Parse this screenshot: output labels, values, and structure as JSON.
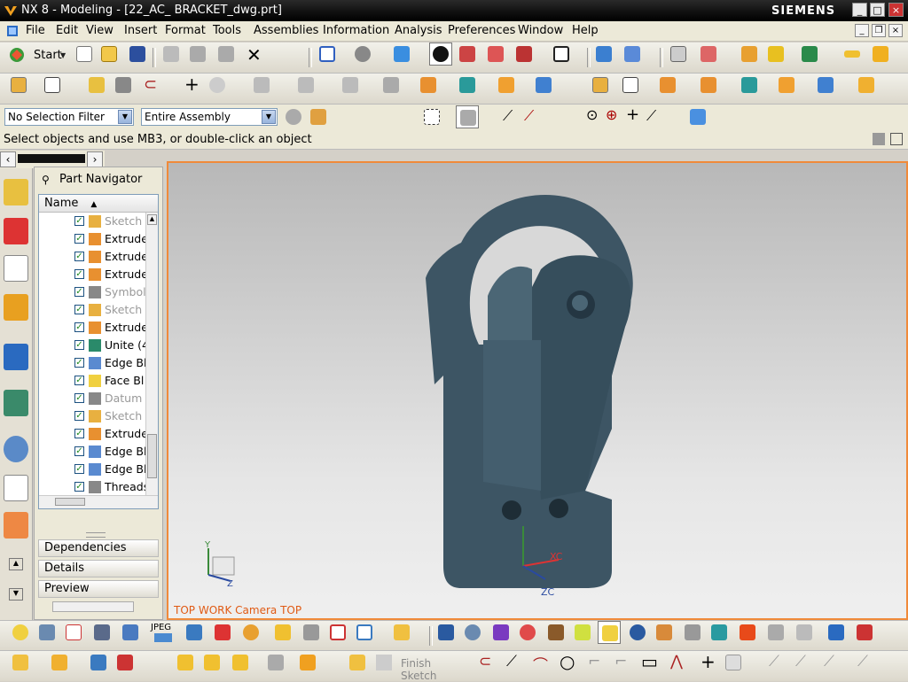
{
  "titlebar": {
    "title": "NX 8 - Modeling - [22_AC_ BRACKET_dwg.prt]",
    "brand": "SIEMENS"
  },
  "menubar": {
    "items": [
      "File",
      "Edit",
      "View",
      "Insert",
      "Format",
      "Tools",
      "Assemblies",
      "Information",
      "Analysis",
      "Preferences",
      "Window",
      "Help"
    ]
  },
  "toolbar": {
    "start_label": "Start",
    "jpeg_label": "JPEG",
    "finish_sketch_label": "Finish Sketch"
  },
  "selection": {
    "filter_value": "No Selection Filter",
    "scope_value": "Entire Assembly"
  },
  "status": {
    "message": "Select objects and use MB3, or double-click an object"
  },
  "navigator": {
    "title": "Part Navigator",
    "column_header": "Name",
    "items": [
      {
        "label": "Sketch",
        "dim": true
      },
      {
        "label": "Extrude",
        "dim": false
      },
      {
        "label": "Extrude",
        "dim": false
      },
      {
        "label": "Extrude",
        "dim": false
      },
      {
        "label": "Symbol",
        "dim": true
      },
      {
        "label": "Sketch",
        "dim": true
      },
      {
        "label": "Extrude",
        "dim": false
      },
      {
        "label": "Unite (4",
        "dim": false
      },
      {
        "label": "Edge Bl",
        "dim": false
      },
      {
        "label": "Face Bl",
        "dim": false
      },
      {
        "label": "Datum",
        "dim": true
      },
      {
        "label": "Sketch",
        "dim": true
      },
      {
        "label": "Extrude",
        "dim": false
      },
      {
        "label": "Edge Bl",
        "dim": false
      },
      {
        "label": "Edge Bl",
        "dim": false
      },
      {
        "label": "Threads",
        "dim": false
      }
    ],
    "panels": [
      "Dependencies",
      "Details",
      "Preview"
    ]
  },
  "viewport": {
    "view_label": "TOP WORK Camera TOP",
    "triad_labels": {
      "y": "Y",
      "z": "Z"
    },
    "wcs_labels": {
      "xc": "XC",
      "zc": "ZC"
    }
  },
  "colors": {
    "viewport_border": "#f08a3a",
    "model": "#3d5564",
    "label": "#e05a14"
  }
}
